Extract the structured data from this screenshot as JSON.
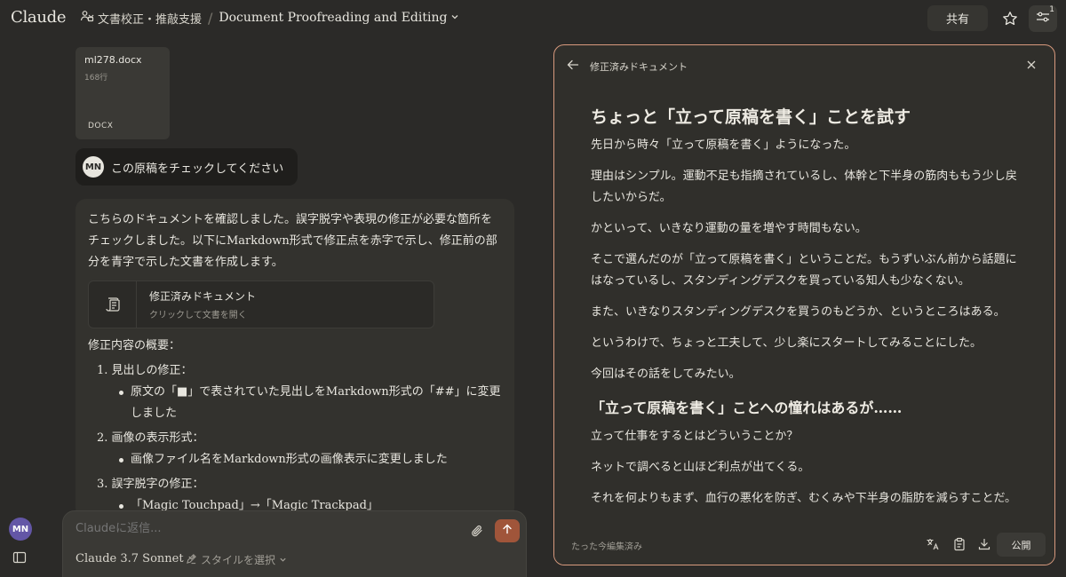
{
  "app": {
    "logo": "Claude"
  },
  "header": {
    "project_name": "文書校正・推敲支援",
    "separator": "/",
    "conversation_title": "Document Proofreading and Editing",
    "share_label": "共有",
    "settings_badge": "1"
  },
  "user": {
    "initials": "MN"
  },
  "file": {
    "name": "ml278.docx",
    "lines": "168行",
    "type": "DOCX"
  },
  "user_message": {
    "initials": "MN",
    "text": "この原稿をチェックしてください"
  },
  "assistant": {
    "intro": "こちらのドキュメントを確認しました。誤字脱字や表現の修正が必要な箇所をチェックしました。以下にMarkdown形式で修正点を赤字で示し、修正前の部分を青字で示した文書を作成します。",
    "artifact_title": "修正済みドキュメント",
    "artifact_subtitle": "クリックして文書を開く",
    "summary_title": "修正内容の概要：",
    "items": [
      {
        "title": "1. 見出しの修正：",
        "bullet": "原文の「■」で表されていた見出しをMarkdown形式の「##」に変更しました"
      },
      {
        "title": "2. 画像の表示形式：",
        "bullet": "画像ファイル名をMarkdown形式の画像表示に変更しました"
      },
      {
        "title": "3. 誤字脱字の修正：",
        "bullet": "「Magic Touchpad」→「Magic Trackpad」"
      }
    ]
  },
  "composer": {
    "placeholder": "Claudeに返信...",
    "model": "Claude 3.7 Sonnet",
    "style": "スタイルを選択"
  },
  "panel": {
    "title": "修正済みドキュメント",
    "h1": "ちょっと「立って原稿を書く」ことを試す",
    "paragraphs_1": [
      "先日から時々「立って原稿を書く」ようになった。",
      "理由はシンプル。運動不足も指摘されているし、体幹と下半身の筋肉ももう少し戻したいからだ。",
      "かといって、いきなり運動の量を増やす時間もない。",
      "そこで選んだのが「立って原稿を書く」ということだ。もうずいぶん前から話題にはなっているし、スタンディングデスクを買っている知人も少なくない。",
      "また、いきなりスタンディングデスクを買うのもどうか、というところはある。",
      "というわけで、ちょっと工夫して、少し楽にスタートしてみることにした。",
      "今回はその話をしてみたい。"
    ],
    "h2": "「立って原稿を書く」ことへの憧れはあるが……",
    "paragraphs_2": [
      "立って仕事をするとはどういうことか？",
      "ネットで調べると山ほど利点が出てくる。",
      "それを何よりもまず、血行の悪化を防ぎ、むくみや下半身の脂肪を減らすことだ。"
    ],
    "edited_label": "たった今編集済み",
    "publish_label": "公開"
  },
  "colors": {
    "accent": "#d89a7e",
    "send": "#a0553a",
    "avatar": "#6356a6"
  }
}
